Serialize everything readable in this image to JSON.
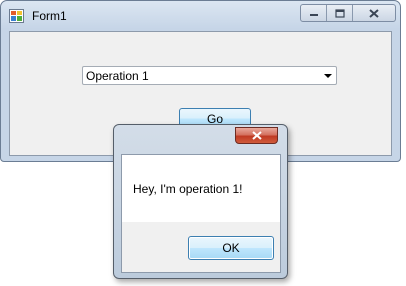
{
  "main_window": {
    "title": "Form1",
    "icon": "form-app-icon",
    "caption_buttons": [
      "minimize-icon",
      "maximize-icon",
      "close-icon"
    ],
    "combo": {
      "value": "Operation 1"
    },
    "go_label": "Go"
  },
  "message_box": {
    "text": "Hey, I'm operation 1!",
    "ok_label": "OK",
    "close_icon": "close-icon"
  },
  "colors": {
    "title_bar": "#c6d5e7",
    "client_bg": "#f0f0f0",
    "button_border": "#3c7fb1",
    "close_red": "#c03a23"
  }
}
